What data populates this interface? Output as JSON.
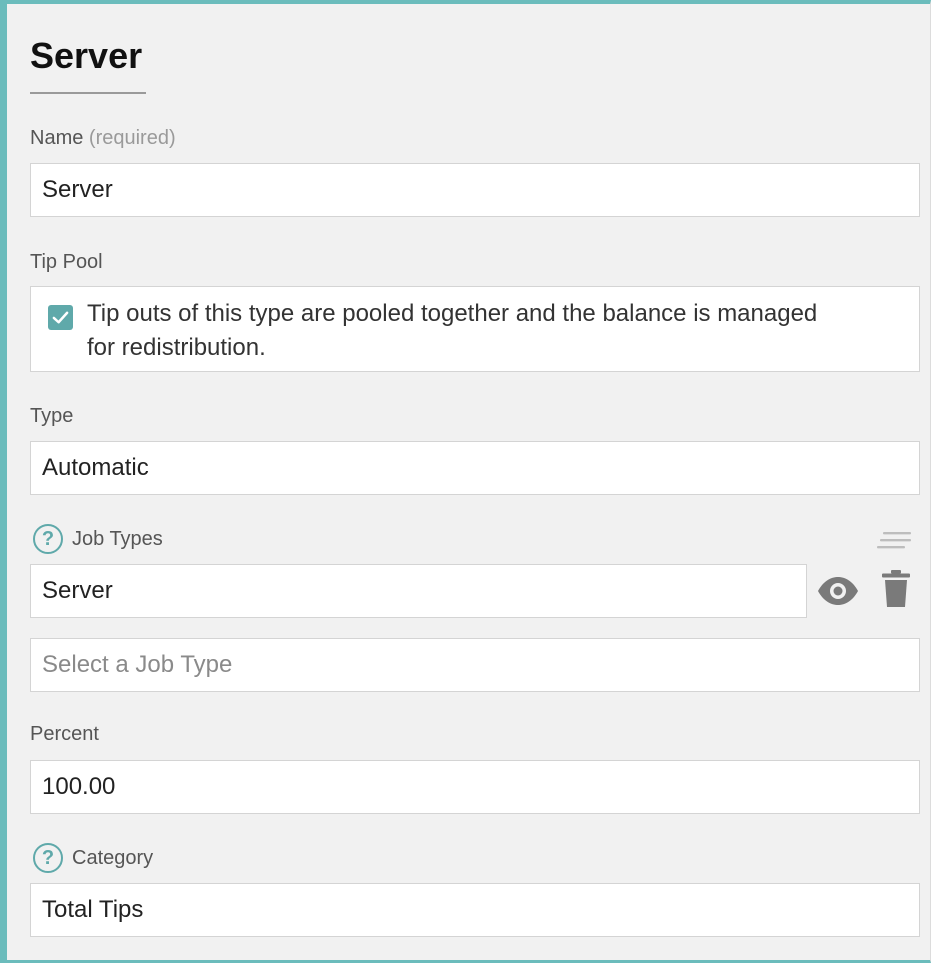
{
  "header": {
    "title": "Server"
  },
  "name_field": {
    "label": "Name",
    "hint": "(required)",
    "value": "Server"
  },
  "tip_pool": {
    "label": "Tip Pool",
    "checked": true,
    "checkbox_text": "Tip outs of this type are pooled together and the balance is managed for redistribution."
  },
  "type_field": {
    "label": "Type",
    "value": "Automatic"
  },
  "job_types": {
    "label": "Job Types",
    "items": [
      {
        "value": "Server"
      }
    ],
    "placeholder": "Select a Job Type"
  },
  "percent_field": {
    "label": "Percent",
    "value": "100.00"
  },
  "category_field": {
    "label": "Category",
    "value": "Total Tips"
  },
  "icons": {
    "help": "help-circle-icon",
    "sort": "drag-handle-icon",
    "view": "eye-icon",
    "delete": "trash-icon",
    "check": "checkmark-icon"
  },
  "colors": {
    "accent": "#5fa9aa",
    "frame": "#6bbcbc",
    "panel_bg": "#f1f1f1",
    "icon_gray": "#7a7a7a"
  }
}
